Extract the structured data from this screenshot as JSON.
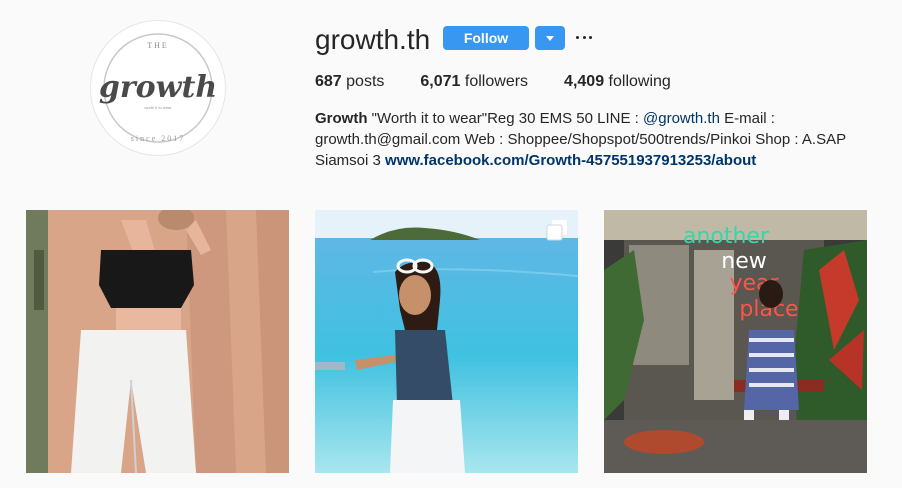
{
  "profile": {
    "username": "growth.th",
    "avatar_icon": "growth-logo",
    "avatar_text": {
      "top": "THE",
      "main": "growth",
      "tag": "worth it to wear",
      "bottom": "since 2017"
    }
  },
  "actions": {
    "follow_label": "Follow",
    "dropdown_icon": "chevron-down-icon",
    "more_icon": "ellipsis-icon",
    "accent_color": "#3897f0"
  },
  "stats": [
    {
      "count": "687",
      "label": "posts"
    },
    {
      "count": "6,071",
      "label": "followers"
    },
    {
      "count": "4,409",
      "label": "following"
    }
  ],
  "bio": {
    "name": "Growth",
    "text_1": " \"Worth it to wear\"Reg 30 EMS 50 LINE : ",
    "mention": "@growth.th",
    "text_2": " E-mail : growth.th@gmail.com Web : Shoppee/Shopspot/500trends/Pinkoi Shop : A.SAP Siamsoi 3 ",
    "link": "www.facebook.com/Growth-457551937913253/about"
  },
  "posts": [
    {
      "description": "black-off-shoulder-top-white-pants",
      "multi": false
    },
    {
      "description": "beach-sea-photo",
      "multi": true
    },
    {
      "description": "shop-front-neon-another-new-year",
      "multi": false,
      "neon_text": [
        "another",
        "new",
        "year",
        "place"
      ]
    }
  ]
}
